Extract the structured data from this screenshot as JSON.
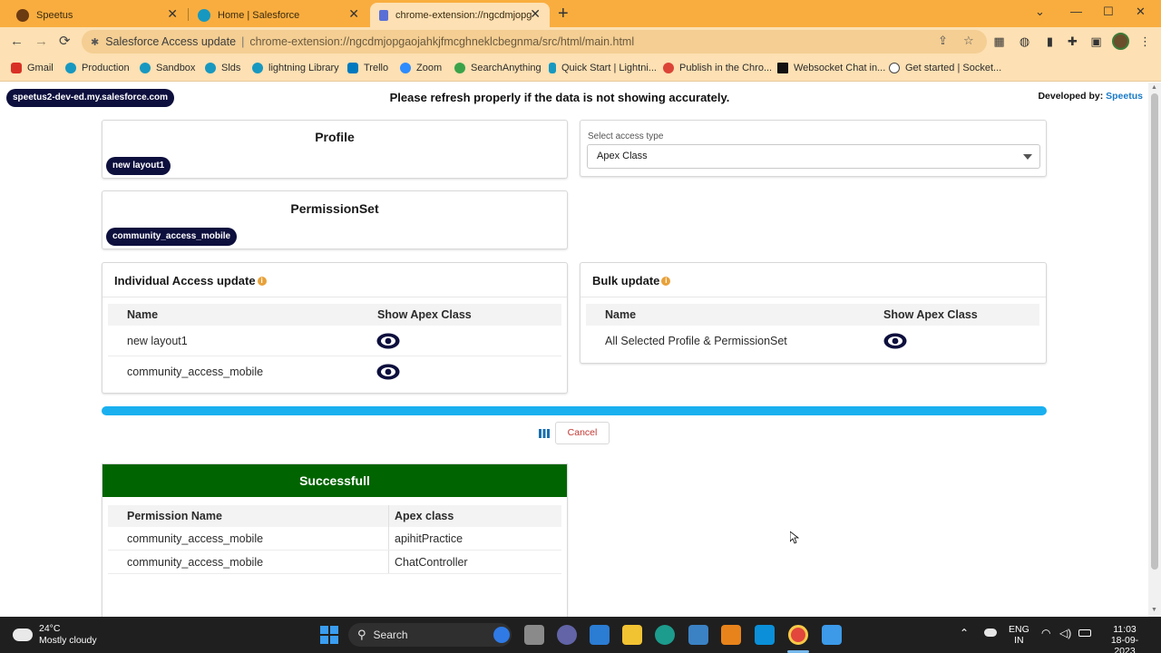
{
  "browser": {
    "tabs": [
      {
        "label": "Speetus",
        "active": false
      },
      {
        "label": "Home | Salesforce",
        "active": false
      },
      {
        "label": "chrome-extension://ngcdmjopg...",
        "active": true
      }
    ],
    "new_tab": "+",
    "url_title": "Salesforce Access update",
    "url_sep": "|",
    "url": "chrome-extension://ngcdmjopgaojahkjfmcghneklcbegnma/src/html/main.html",
    "bookmarks": [
      {
        "label": "Gmail",
        "color": "#d93025"
      },
      {
        "label": "Production",
        "color": "#1798c1"
      },
      {
        "label": "Sandbox",
        "color": "#1798c1"
      },
      {
        "label": "Slds",
        "color": "#1798c1"
      },
      {
        "label": "lightning Library",
        "color": "#1798c1"
      },
      {
        "label": "Trello",
        "color": "#0079bf"
      },
      {
        "label": "Zoom",
        "color": "#2d8cff"
      },
      {
        "label": "SearchAnything",
        "color": "#3aa34a"
      },
      {
        "label": "Quick Start | Lightni...",
        "color": "#1798c1"
      },
      {
        "label": "Publish in the Chro...",
        "color": "#db4437"
      },
      {
        "label": "Websocket Chat in...",
        "color": "#111111"
      },
      {
        "label": "Get started | Socket...",
        "color": "#444444"
      }
    ]
  },
  "header": {
    "org": "speetus2-dev-ed.my.salesforce.com",
    "notice": "Please refresh properly if the data is not showing accurately.",
    "developed_by": "Developed by:",
    "developer": "Speetus"
  },
  "profile": {
    "title": "Profile",
    "selected": "new layout1"
  },
  "permission_set": {
    "title": "PermissionSet",
    "selected": "community_access_mobile"
  },
  "access_type": {
    "label": "Select access type",
    "value": "Apex Class"
  },
  "individual": {
    "title": "Individual Access update",
    "col_name": "Name",
    "col_action": "Show Apex Class",
    "rows": [
      {
        "name": "new layout1"
      },
      {
        "name": "community_access_mobile"
      }
    ]
  },
  "bulk": {
    "title": "Bulk update",
    "col_name": "Name",
    "col_action": "Show Apex Class",
    "rows": [
      {
        "name": "All Selected Profile & PermissionSet"
      }
    ]
  },
  "progress": {
    "value": 1.0,
    "color": "#1ab0ef"
  },
  "actions": {
    "cancel": "Cancel"
  },
  "result": {
    "title": "Successfull",
    "header_color": "#006400",
    "col_permission": "Permission Name",
    "col_apex": "Apex class",
    "rows": [
      {
        "permission": "community_access_mobile",
        "apex": "apihitPractice"
      },
      {
        "permission": "community_access_mobile",
        "apex": "ChatController"
      }
    ]
  },
  "taskbar": {
    "temperature": "24°C",
    "weather": "Mostly cloudy",
    "search": "Search",
    "lang_top": "ENG",
    "lang_bottom": "IN",
    "time": "11:03",
    "date": "18-09-2023"
  }
}
